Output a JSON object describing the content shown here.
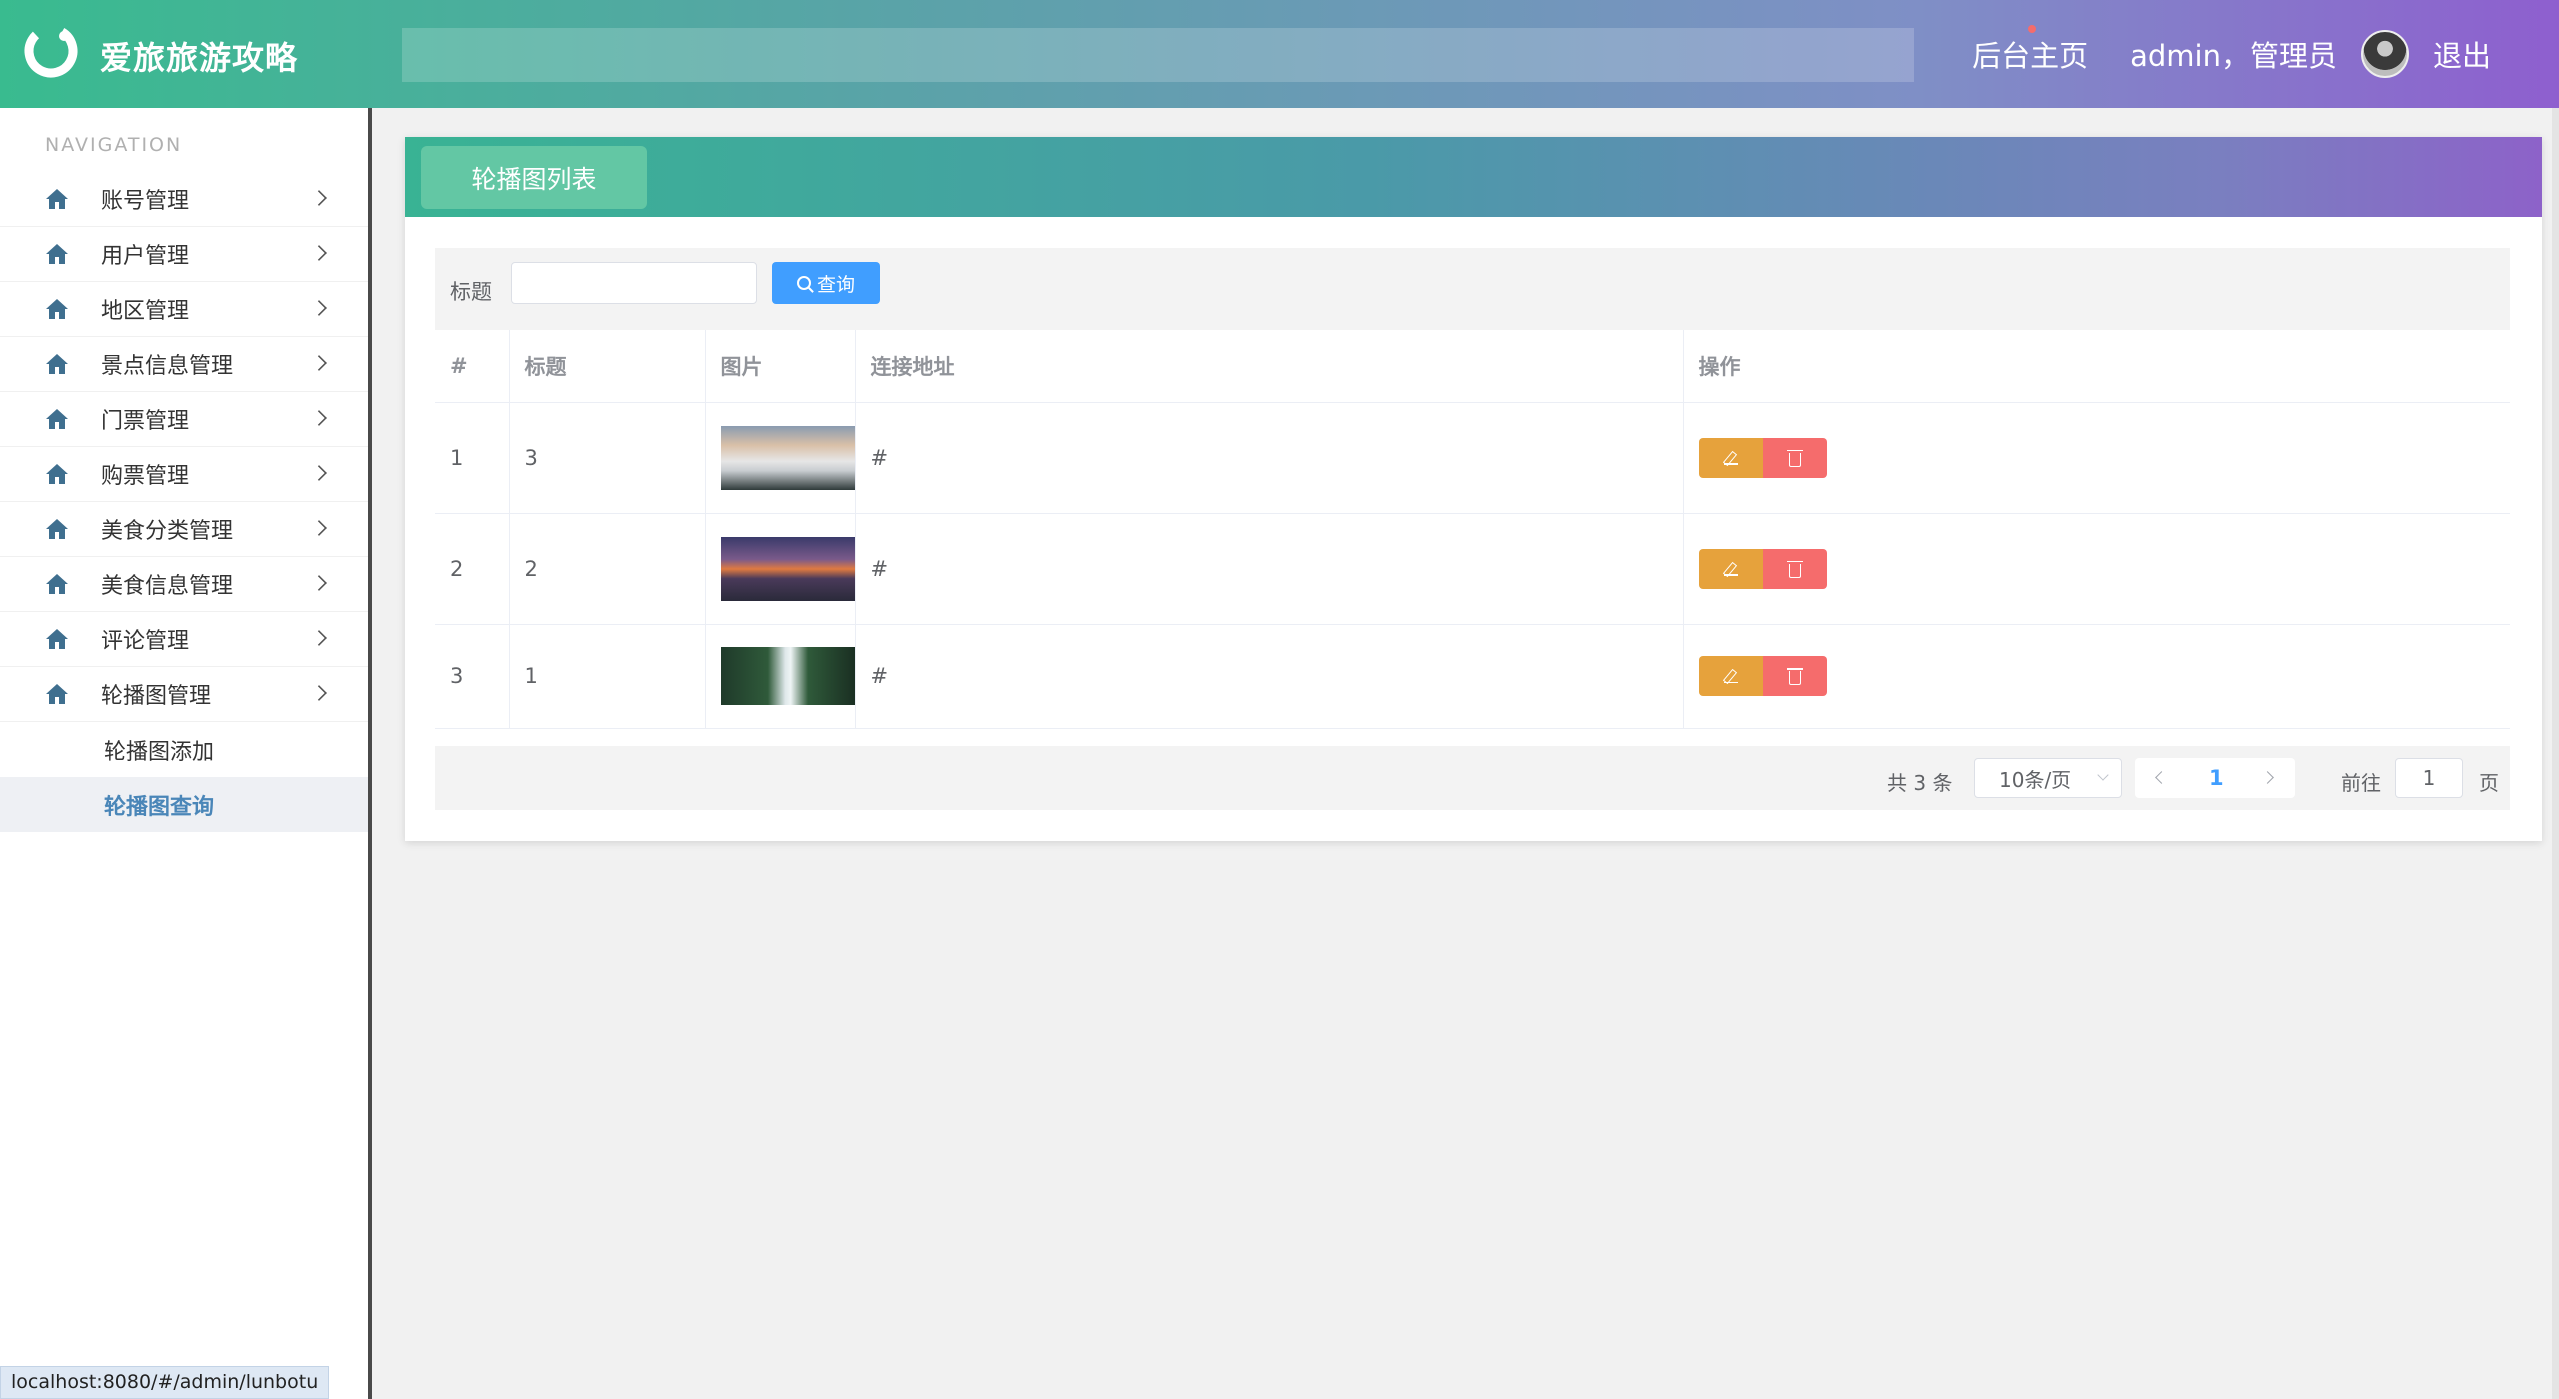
{
  "header": {
    "brand": "爱旅旅游攻略",
    "home_link": "后台主页",
    "user_text": "admin，管理员",
    "logout": "退出",
    "colors": {
      "start": "#39bb8f",
      "end": "#8e5fcf"
    }
  },
  "sidebar": {
    "nav_title": "NAVIGATION",
    "items": [
      {
        "label": "账号管理",
        "icon": "home-icon"
      },
      {
        "label": "用户管理",
        "icon": "home-icon"
      },
      {
        "label": "地区管理",
        "icon": "home-icon"
      },
      {
        "label": "景点信息管理",
        "icon": "home-icon"
      },
      {
        "label": "门票管理",
        "icon": "home-icon"
      },
      {
        "label": "购票管理",
        "icon": "home-icon"
      },
      {
        "label": "美食分类管理",
        "icon": "home-icon"
      },
      {
        "label": "美食信息管理",
        "icon": "home-icon"
      },
      {
        "label": "评论管理",
        "icon": "home-icon"
      },
      {
        "label": "轮播图管理",
        "icon": "home-icon"
      }
    ],
    "sub_items": [
      {
        "label": "轮播图添加",
        "active": false
      },
      {
        "label": "轮播图查询",
        "active": true
      }
    ]
  },
  "main": {
    "tab_title": "轮播图列表",
    "search": {
      "label": "标题",
      "value": "",
      "button": "查询"
    },
    "table": {
      "headers": [
        "#",
        "标题",
        "图片",
        "连接地址",
        "操作"
      ],
      "rows": [
        {
          "index": "1",
          "title": "3",
          "image": "mountain-clouds-photo",
          "link": "#"
        },
        {
          "index": "2",
          "title": "2",
          "image": "sunset-mountains-photo",
          "link": "#"
        },
        {
          "index": "3",
          "title": "1",
          "image": "waterfall-photo",
          "link": "#"
        }
      ]
    },
    "pagination": {
      "total": "共 3 条",
      "page_size": "10条/页",
      "current": "1",
      "goto_label": "前往",
      "goto_value": "1",
      "page_suffix": "页"
    }
  },
  "status_bar": {
    "url": "localhost:8080/#/admin/lunbotu"
  },
  "colors": {
    "primary": "#409eff",
    "edit": "#e6a23c",
    "delete": "#f56c6c",
    "active_menu": "#4a86b8"
  }
}
